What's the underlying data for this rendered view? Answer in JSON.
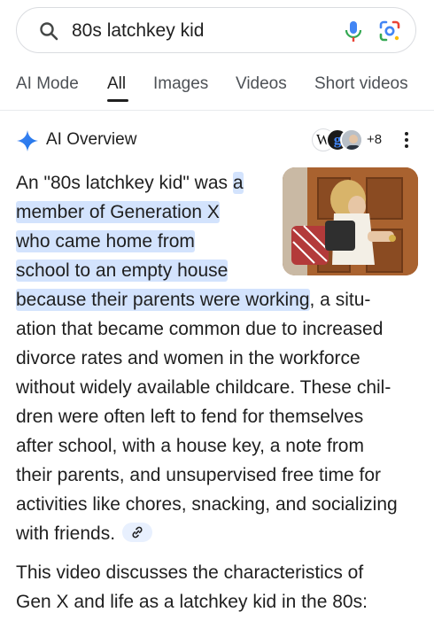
{
  "search": {
    "query": "80s latchkey kid"
  },
  "tabs": [
    {
      "label": "AI Mode"
    },
    {
      "label": "All"
    },
    {
      "label": "Images"
    },
    {
      "label": "Videos"
    },
    {
      "label": "Short videos"
    }
  ],
  "ai_overview": {
    "title": "AI Overview",
    "sources_badge_w": "W",
    "sources_badge_g": "g",
    "sources_count": "+8",
    "lines": [
      {
        "plain": "An \"80s latchkey kid\" was ",
        "hl": "a"
      },
      {
        "plain": "",
        "hl": "member of Generation X"
      },
      {
        "plain": "",
        "hl": "who came home from"
      },
      {
        "plain": "",
        "hl": "school to an empty house"
      },
      {
        "plain": ", a situ-",
        "hl": "because their parents were working"
      },
      {
        "plain": "ation that became common due to increased",
        "hl": ""
      },
      {
        "plain": "divorce rates and women in the workforce",
        "hl": ""
      },
      {
        "plain": "without widely available childcare. These chil-",
        "hl": ""
      },
      {
        "plain": "dren were often left to fend for themselves",
        "hl": ""
      },
      {
        "plain": "after school, with a house key, a note from",
        "hl": ""
      },
      {
        "plain": "their parents, and unsupervised free time for",
        "hl": ""
      },
      {
        "plain": "activities like chores, snacking, and socializing",
        "hl": ""
      },
      {
        "plain": "with friends.",
        "hl": ""
      }
    ],
    "para2_line1": "This video discusses the characteristics of",
    "para2_line2": "Gen X and life as a latchkey kid in the 80s:"
  },
  "colors": {
    "highlight": "#d3e3fd",
    "accent_blue": "#1a73e8"
  },
  "icons": [
    "search-icon",
    "mic-icon",
    "lens-icon",
    "ai-spark-icon",
    "more-vert-icon",
    "link-icon"
  ]
}
